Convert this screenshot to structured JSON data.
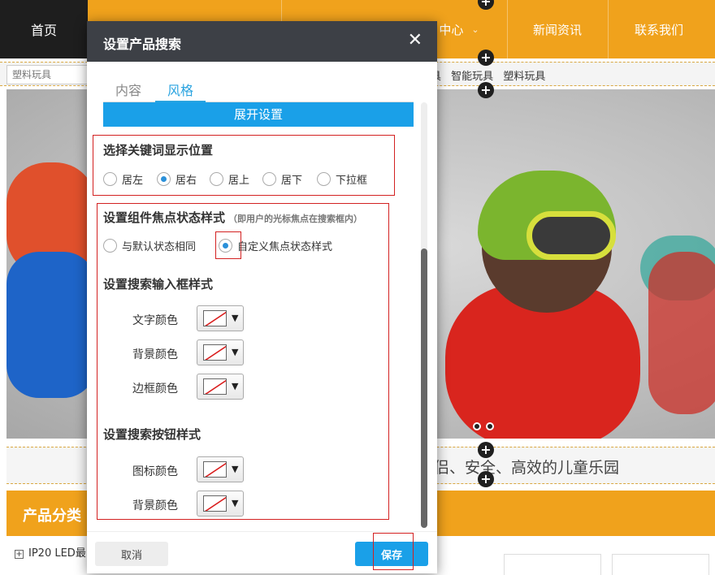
{
  "site": {
    "nav": {
      "home": "首页",
      "product_partial": "中心",
      "news": "新闻资讯",
      "contact": "联系我们"
    },
    "search_placeholder": "塑料玩具",
    "keywords": [
      "具",
      "智能玩具",
      "塑料玩具"
    ],
    "slogan_partial": "侣、安全、高效的儿童乐园",
    "category_title_partial": "产品分类",
    "category_item_partial": "IP20 LED最"
  },
  "dialog": {
    "title": "设置产品搜索",
    "close_symbol": "✕",
    "tabs": [
      {
        "label": "内容",
        "active": false
      },
      {
        "label": "风格",
        "active": true
      }
    ],
    "expand_label": "展开设置",
    "keyword_position": {
      "title": "选择关键词显示位置",
      "options": [
        "居左",
        "居右",
        "居上",
        "居下",
        "下拉框"
      ],
      "selected": "居右"
    },
    "focus_style": {
      "title": "设置组件焦点状态样式",
      "note": "（即用户的光标焦点在搜索框内）",
      "options": [
        "与默认状态相同",
        "自定义焦点状态样式"
      ],
      "selected": "自定义焦点状态样式"
    },
    "input_style": {
      "title": "设置搜索输入框样式",
      "rows": [
        {
          "label": "文字颜色"
        },
        {
          "label": "背景颜色"
        },
        {
          "label": "边框颜色"
        }
      ]
    },
    "button_style": {
      "title": "设置搜索按钮样式",
      "rows": [
        {
          "label": "图标颜色"
        },
        {
          "label": "背景颜色"
        }
      ]
    },
    "cancel_label": "取消",
    "save_label": "保存"
  },
  "colors": {
    "accent": "#1aa0e8",
    "nav_orange": "#f0a21c",
    "header_dark": "#3d4046",
    "highlight_red": "#d32121"
  },
  "icons": {
    "close": "close-icon",
    "add_handle": "plus-icon",
    "color_none": "no-color-swatch-icon",
    "dropdown": "caret-down-icon"
  }
}
